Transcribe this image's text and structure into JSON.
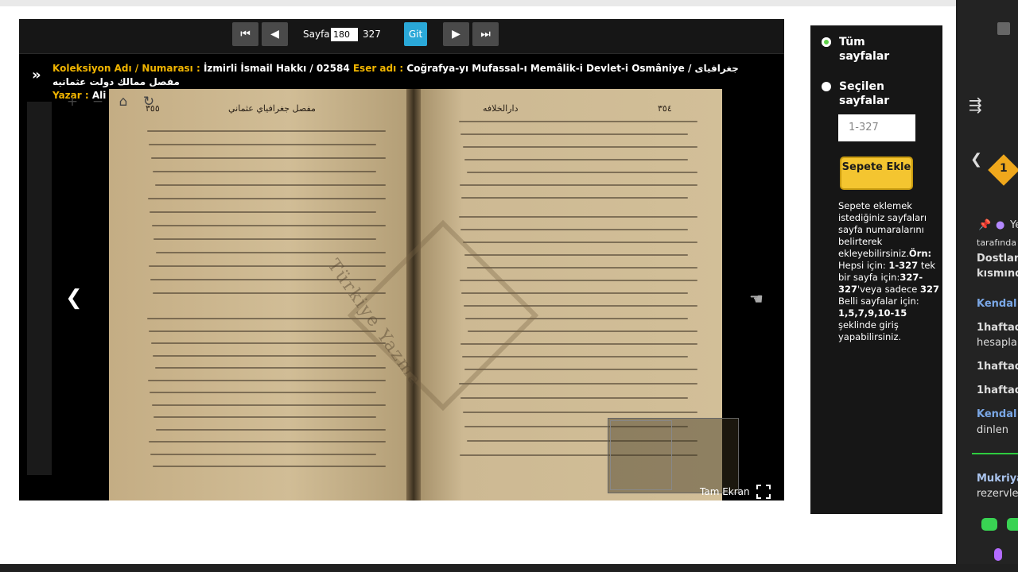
{
  "toolbar": {
    "page_label": "Sayfa",
    "page_value": "180",
    "page_total": "327",
    "go_label": "Git"
  },
  "meta": {
    "collection_label": "Koleksiyon Adı / Numarası :",
    "collection_value": "İzmirli İsmail Hakkı / 02584",
    "work_label": "Eser adı :",
    "work_value": "Coğrafya-yı Mufassal-ı Memâlik-i Devlet-i Osmâniye / جغرافيای مفصل ممالك دولت عثمانيه",
    "author_label": "Yazar :",
    "author_value": "Ali Saib / علي صائب"
  },
  "book": {
    "left_page_number": "٣٥٥",
    "left_header": "مفصل جغرافياي عثماني",
    "right_page_number": "٣٥٤",
    "right_header": "دارالخلافه",
    "watermark": "Türkiye Yazma"
  },
  "fullscreen_label": "Tam Ekran",
  "panel": {
    "all_pages_label": "Tüm sayfalar",
    "selected_pages_label": "Seçilen sayfalar",
    "range_placeholder": "1-327",
    "add_to_cart_label": "Sepete Ekle",
    "help_intro": "Sepete eklemek istediğiniz sayfaları sayfa numaralarını belirterek ekleyebilirsiniz.",
    "help_example": "Örn:",
    "help_all_prefix": "Hepsi için: ",
    "help_all_value": "1-327",
    "help_single_prefix": " tek bir sayfa için:",
    "help_single_value": "327-327",
    "help_or": "'veya sadece ",
    "help_only_value": "327",
    "help_certain": " Belli sayfalar için: ",
    "help_certain_value": "1,5,7,9,10-15",
    "help_suffix": " şeklinde giriş yapabilirsiniz."
  },
  "side_app": {
    "badge": "1",
    "t1": "tarafında",
    "t2": "Dostlar",
    "t3": "kısmında",
    "t4": "Kendal",
    "t5": "1haftad",
    "t6": "hesapla",
    "t7": "1haftad",
    "t8": "1haftad",
    "t9": "Kendal",
    "t10": "dinlen",
    "t11": "Mukriya",
    "t12": "rezervle",
    "t13": "Ye"
  },
  "colors": {
    "accent_label": "#f0b400",
    "go_button": "#2aa8d8",
    "cart_button": "#f4c530",
    "radio_active": "#5fd14a"
  }
}
